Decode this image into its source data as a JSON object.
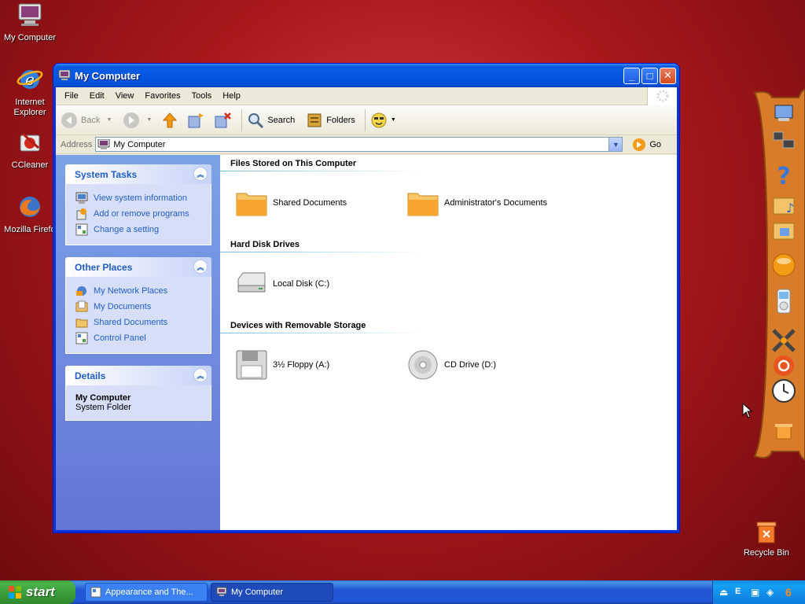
{
  "desktop": {
    "icons": [
      {
        "label": "My Computer"
      },
      {
        "label": "Internet Explorer"
      },
      {
        "label": "CCleaner"
      },
      {
        "label": "Mozilla Firefo"
      }
    ],
    "recycle_bin": "Recycle Bin"
  },
  "window": {
    "title": "My Computer",
    "controls": {
      "minimize": "_",
      "maximize": "□",
      "close": "✕"
    }
  },
  "menubar": [
    "File",
    "Edit",
    "View",
    "Favorites",
    "Tools",
    "Help"
  ],
  "toolbar": {
    "back": "Back",
    "search": "Search",
    "folders": "Folders"
  },
  "address": {
    "label": "Address",
    "value": "My Computer",
    "go": "Go"
  },
  "tasks_pane": {
    "system_tasks": {
      "title": "System Tasks",
      "items": [
        "View system information",
        "Add or remove programs",
        "Change a setting"
      ]
    },
    "other_places": {
      "title": "Other Places",
      "items": [
        "My Network Places",
        "My Documents",
        "Shared Documents",
        "Control Panel"
      ]
    },
    "details": {
      "title": "Details",
      "name": "My Computer",
      "type": "System Folder"
    }
  },
  "groups": [
    {
      "title": "Files Stored on This Computer",
      "items": [
        "Shared Documents",
        "Administrator's Documents"
      ]
    },
    {
      "title": "Hard Disk Drives",
      "items": [
        "Local Disk (C:)"
      ]
    },
    {
      "title": "Devices with Removable Storage",
      "items": [
        "3½ Floppy (A:)",
        "CD Drive (D:)"
      ]
    }
  ],
  "taskbar": {
    "start": "start",
    "tasks": [
      {
        "label": "Appearance and The...",
        "active": false
      },
      {
        "label": "My Computer",
        "active": true
      }
    ],
    "clock": "6"
  },
  "colors": {
    "title_blue": "#0458e5",
    "task_link": "#215dc6",
    "desktop_red": "#a8181b"
  }
}
